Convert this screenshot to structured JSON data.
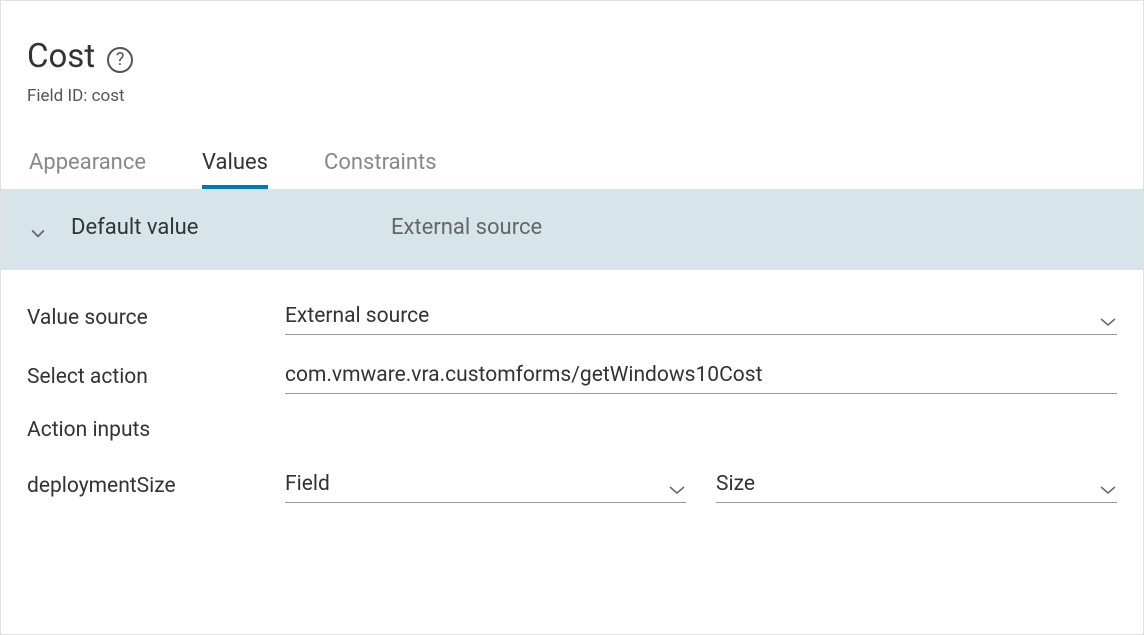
{
  "header": {
    "title": "Cost",
    "fieldId": "Field ID: cost"
  },
  "tabs": {
    "appearance": "Appearance",
    "values": "Values",
    "constraints": "Constraints"
  },
  "section": {
    "label": "Default value",
    "value": "External source"
  },
  "form": {
    "valueSource": {
      "label": "Value source",
      "value": "External source"
    },
    "selectAction": {
      "label": "Select action",
      "value": "com.vmware.vra.customforms/getWindows10Cost"
    },
    "actionInputs": {
      "label": "Action inputs"
    },
    "deploymentSize": {
      "label": "deploymentSize",
      "type": "Field",
      "field": "Size"
    }
  }
}
